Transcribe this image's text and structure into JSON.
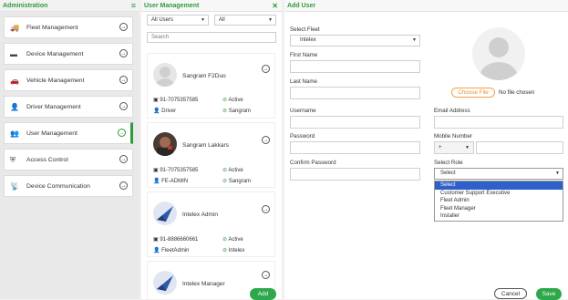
{
  "admin": {
    "title": "Administration",
    "items": [
      {
        "label": "Fleet Management",
        "icon": "truck-icon"
      },
      {
        "label": "Device Management",
        "icon": "device-icon"
      },
      {
        "label": "Vehicle Management",
        "icon": "car-icon"
      },
      {
        "label": "Driver Management",
        "icon": "driver-icon"
      },
      {
        "label": "User Management",
        "icon": "users-icon",
        "active": true
      },
      {
        "label": "Access Control",
        "icon": "shield-icon"
      },
      {
        "label": "Device Communication",
        "icon": "satellite-icon"
      }
    ]
  },
  "users": {
    "title": "User Management",
    "filter1": "All Users",
    "filter2": "All",
    "search_placeholder": "Search",
    "cards": [
      {
        "name": "Sangram F2Duo",
        "phone": "91-7075357585",
        "status": "Active",
        "role": "Driver",
        "owner": "Sangram"
      },
      {
        "name": "Sangram Lakkars",
        "phone": "91-7075357585",
        "status": "Active",
        "role": "FE-ADMIN",
        "owner": "Sangram"
      },
      {
        "name": "Intelex Admin",
        "phone": "91-8886660661",
        "status": "Active",
        "role": "FleetAdmin",
        "owner": "Intelex"
      },
      {
        "name": "Intelex Manager"
      }
    ],
    "add_label": "Add"
  },
  "form": {
    "title": "Add User",
    "select_fleet_label": "Select Fleet",
    "select_fleet_value": "Intelex",
    "first_name_label": "First Name",
    "last_name_label": "Last Name",
    "username_label": "Username",
    "password_label": "Password",
    "confirm_password_label": "Confirm Password",
    "email_label": "Email Address",
    "mobile_label": "Mobile Number",
    "mobile_code": "+",
    "role_label": "Select Role",
    "role_value": "Select",
    "role_options": [
      "Select",
      "Customer Support Executive",
      "Fleet Admin",
      "Fleet Manager",
      "Installer"
    ],
    "choose_file": "Choose File",
    "no_file": "No file chosen",
    "cancel": "Cancel",
    "save": "Save"
  }
}
